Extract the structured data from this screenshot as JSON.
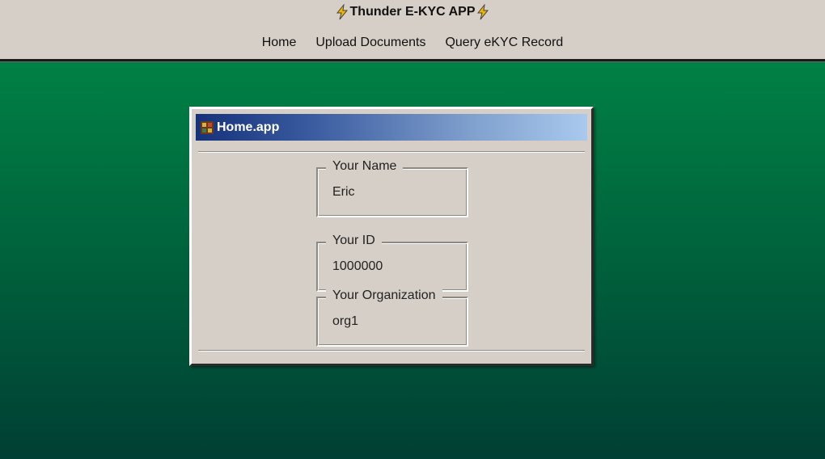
{
  "header": {
    "title": "Thunder E-KYC APP",
    "left_icon": "lightning-bolt-icon",
    "right_icon": "lightning-bolt-icon"
  },
  "nav": {
    "items": [
      {
        "label": "Home"
      },
      {
        "label": "Upload Documents"
      },
      {
        "label": "Query eKYC Record"
      }
    ]
  },
  "window": {
    "title": "Home.app",
    "icon": "app-icon",
    "fields": [
      {
        "legend": "Your Name",
        "value": "Eric"
      },
      {
        "legend": "Your ID",
        "value": "1000000"
      },
      {
        "legend": "Your Organization",
        "value": "org1"
      }
    ]
  },
  "colors": {
    "accent_bolt": "#f4b400",
    "titlebar_start": "#15317a",
    "titlebar_end": "#a9c9ee",
    "background_top": "#008a47",
    "background_bottom": "#003f34",
    "panel": "#d6cfc7"
  }
}
